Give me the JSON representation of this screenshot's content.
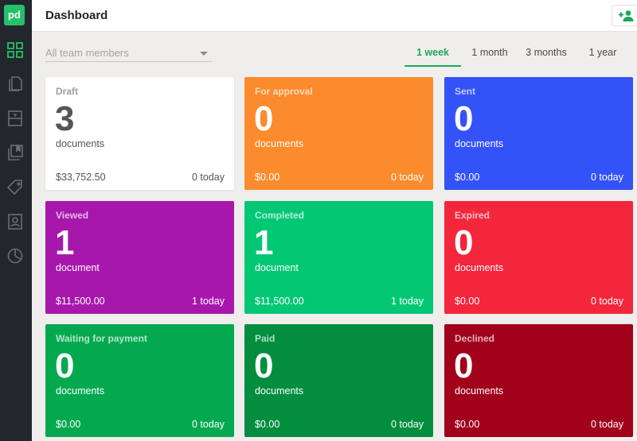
{
  "app": {
    "logo_text": "pd",
    "title": "Dashboard"
  },
  "sidebar": {
    "items": [
      {
        "icon": "dashboard-grid-icon",
        "active": true
      },
      {
        "icon": "documents-icon",
        "active": false
      },
      {
        "icon": "templates-icon",
        "active": false
      },
      {
        "icon": "content-library-icon",
        "active": false
      },
      {
        "icon": "catalog-tag-icon",
        "active": false
      },
      {
        "icon": "contacts-icon",
        "active": false
      },
      {
        "icon": "reports-pie-icon",
        "active": false
      }
    ]
  },
  "header": {
    "add_member_icon": "add-person-icon"
  },
  "filter": {
    "placeholder": "All team members"
  },
  "periods": [
    {
      "label": "1 week",
      "active": true
    },
    {
      "label": "1 month",
      "active": false
    },
    {
      "label": "3 months",
      "active": false
    },
    {
      "label": "1 year",
      "active": false
    }
  ],
  "colors": {
    "accent": "#1ea85a",
    "sidebar": "#23262c"
  },
  "cards": [
    {
      "title": "Draft",
      "count": "3",
      "unit": "documents",
      "amount": "$33,752.50",
      "today": "0 today",
      "color": "#ffffff"
    },
    {
      "title": "For approval",
      "count": "0",
      "unit": "documents",
      "amount": "$0.00",
      "today": "0 today",
      "color": "#fb8b2c"
    },
    {
      "title": "Sent",
      "count": "0",
      "unit": "documents",
      "amount": "$0.00",
      "today": "0 today",
      "color": "#3352f8"
    },
    {
      "title": "Viewed",
      "count": "1",
      "unit": "document",
      "amount": "$11,500.00",
      "today": "1 today",
      "color": "#a717ac"
    },
    {
      "title": "Completed",
      "count": "1",
      "unit": "document",
      "amount": "$11,500.00",
      "today": "1 today",
      "color": "#04c774"
    },
    {
      "title": "Expired",
      "count": "0",
      "unit": "documents",
      "amount": "$0.00",
      "today": "0 today",
      "color": "#f3263c"
    },
    {
      "title": "Waiting for payment",
      "count": "0",
      "unit": "documents",
      "amount": "$0.00",
      "today": "0 today",
      "color": "#04a94f"
    },
    {
      "title": "Paid",
      "count": "0",
      "unit": "documents",
      "amount": "$0.00",
      "today": "0 today",
      "color": "#028d3f"
    },
    {
      "title": "Declined",
      "count": "0",
      "unit": "documents",
      "amount": "$0.00",
      "today": "0 today",
      "color": "#a1011b"
    }
  ]
}
